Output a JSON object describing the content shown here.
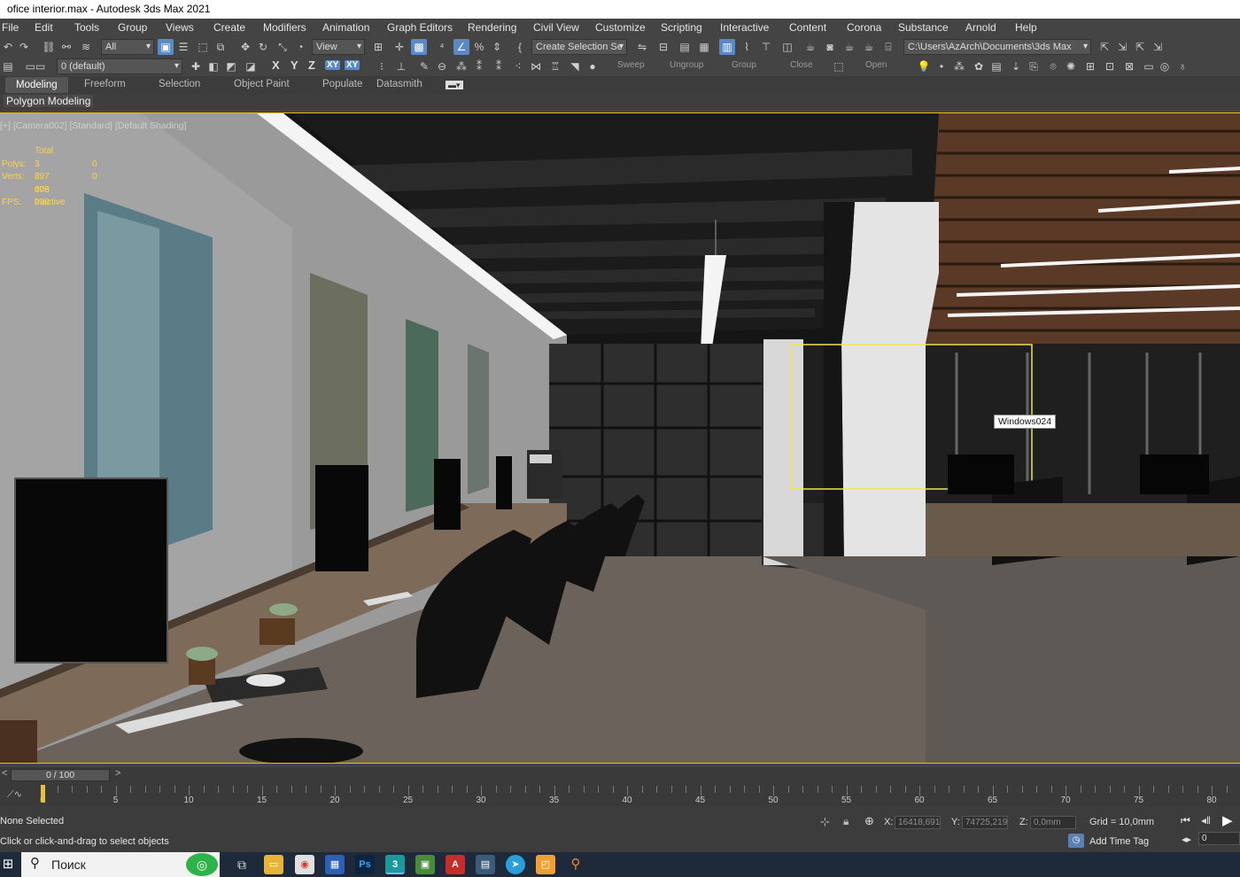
{
  "window": {
    "title": "ofice interior.max - Autodesk 3ds Max 2021"
  },
  "menu": [
    "File",
    "Edit",
    "Tools",
    "Group",
    "Views",
    "Create",
    "Modifiers",
    "Animation",
    "Graph Editors",
    "Rendering",
    "Civil View",
    "Customize",
    "Scripting",
    "Interactive",
    "Content",
    "Corona",
    "Substance",
    "Arnold",
    "Help"
  ],
  "toolbar": {
    "selection_filter": "All",
    "ref_coord": "View",
    "named_selection": "Create Selection Se",
    "project_path": "C:\\Users\\AzArch\\Documents\\3ds Max 2021",
    "layer": "0 (default)",
    "axis": [
      "X",
      "Y",
      "Z",
      "XY",
      "XY"
    ],
    "group_labels": [
      "Sweep",
      "Ungroup",
      "Group",
      "Close",
      "Open"
    ]
  },
  "ribbon": {
    "tabs": [
      "Modeling",
      "Freeform",
      "Selection",
      "Object Paint",
      "Populate",
      "Datasmith"
    ],
    "active_tab": "Modeling",
    "panel": "Polygon Modeling"
  },
  "viewport": {
    "label": "[+] [Camera002] [Standard] [Default Shading]",
    "stats": {
      "header": "Total",
      "polys_label": "Polys:",
      "polys": "3 897 076",
      "polys_sel": "0",
      "verts_label": "Verts:",
      "verts": "3 408 030",
      "verts_sel": "0",
      "fps_label": "FPS:",
      "fps": "Inactive"
    },
    "tooltip": "Windows024"
  },
  "timeline": {
    "slider": "0 / 100",
    "ticks": [
      "0",
      "5",
      "10",
      "15",
      "20",
      "25",
      "30",
      "35",
      "40",
      "45",
      "50",
      "55",
      "60",
      "65",
      "70",
      "75",
      "80"
    ]
  },
  "status": {
    "selection": "None Selected",
    "prompt": "Click or click-and-drag to select objects",
    "x_label": "X:",
    "x": "16418,691",
    "y_label": "Y:",
    "y": "74725,219",
    "z_label": "Z:",
    "z": "0,0mm",
    "grid": "Grid = 10,0mm",
    "add_time_tag": "Add Time Tag",
    "frame": "0"
  },
  "taskbar": {
    "search_placeholder": "Поиск"
  }
}
